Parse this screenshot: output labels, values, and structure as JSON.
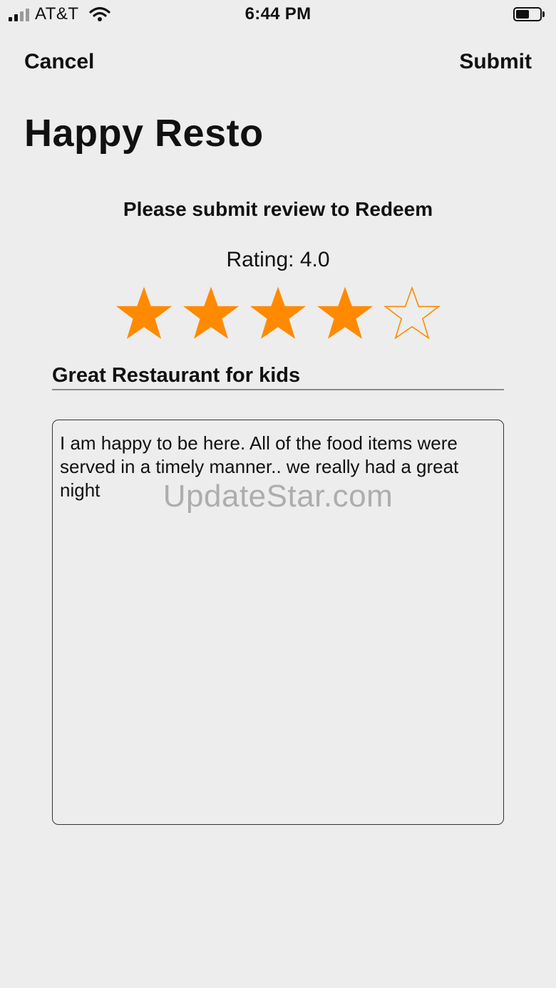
{
  "status_bar": {
    "carrier": "AT&T",
    "time": "6:44 PM"
  },
  "nav": {
    "cancel_label": "Cancel",
    "submit_label": "Submit"
  },
  "page_title": "Happy Resto",
  "subtitle": "Please submit review to Redeem",
  "rating": {
    "label": "Rating: 4.0",
    "value": 4,
    "max": 5,
    "filled_color": "#ff8a00",
    "empty_stroke_color": "#ff8a00"
  },
  "review": {
    "title_value": "Great Restaurant for kids",
    "body_value": "I am happy to be here. All of the food items were served in a timely manner.. we really had a great night"
  },
  "watermark": "UpdateStar.com"
}
